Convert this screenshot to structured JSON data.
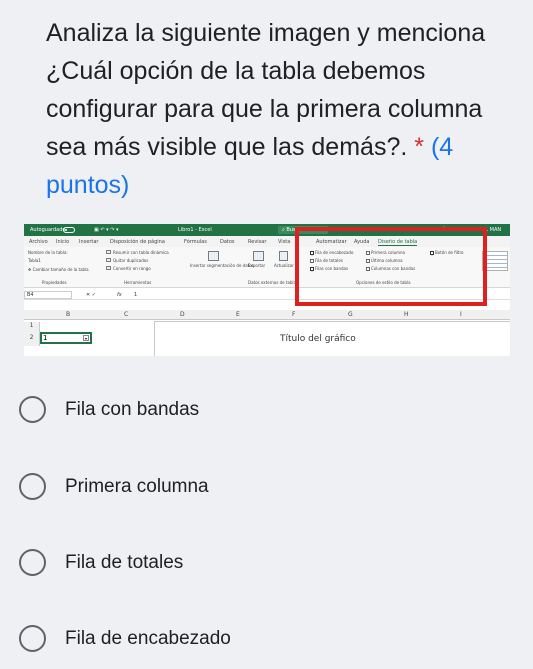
{
  "question": {
    "text": "Analiza la siguiente imagen y menciona ¿Cuál opción de la tabla debemos configurar para que la primera columna sea más visible que las demás?.",
    "required_mark": "*",
    "points": "(4 puntos)"
  },
  "excel": {
    "titlebar": {
      "autosave": "Autoguardado",
      "filename": "Libro1 - Excel",
      "search": "Buscar",
      "user": "RAMÍCHES VILLA REAL MAN"
    },
    "tabs": [
      "Archivo",
      "Inicio",
      "Insertar",
      "Disposición de página",
      "Fórmulas",
      "Datos",
      "Revisar",
      "Vista",
      "Automatizar",
      "Ayuda",
      "Diseño de tabla"
    ],
    "ribbon": {
      "table_name_label": "Nombre de la tabla:",
      "table_name": "Tabla1",
      "resize": "Cambiar tamaño de la tabla",
      "group_properties": "Propiedades",
      "pivot": "Resumir con tabla dinámica",
      "remove_dup": "Quitar duplicados",
      "convert": "Convertir en rango",
      "group_tools": "Herramientas",
      "slicer": "Insertar segmentación de datos",
      "export": "Exportar",
      "refresh": "Actualizar",
      "group_external": "Datos externos de tabla",
      "opt_header": "Fila de encabezado",
      "opt_totals": "Fila de totales",
      "opt_banded_rows": "Filas con bandas",
      "opt_first_col": "Primera columna",
      "opt_last_col": "Última columna",
      "opt_banded_cols": "Columnas con bandas",
      "opt_filter": "Botón de filtro",
      "group_style_opts": "Opciones de estilo de tabla"
    },
    "formula": {
      "namebox": "B4",
      "fx": "fx",
      "value": "1"
    },
    "columns": [
      "B",
      "C",
      "D",
      "E",
      "F",
      "G",
      "H",
      "I"
    ],
    "rows": [
      "1",
      "2"
    ],
    "cell_b2": "1",
    "chart_title": "Título del gráfico"
  },
  "options": [
    {
      "label": "Fila con bandas"
    },
    {
      "label": "Primera columna"
    },
    {
      "label": "Fila de totales"
    },
    {
      "label": "Fila de encabezado"
    }
  ],
  "colors": {
    "background": "#eef0f3",
    "required": "#d93025",
    "points": "#1a73e8",
    "excel_green": "#217346",
    "highlight_box": "#e02020"
  }
}
